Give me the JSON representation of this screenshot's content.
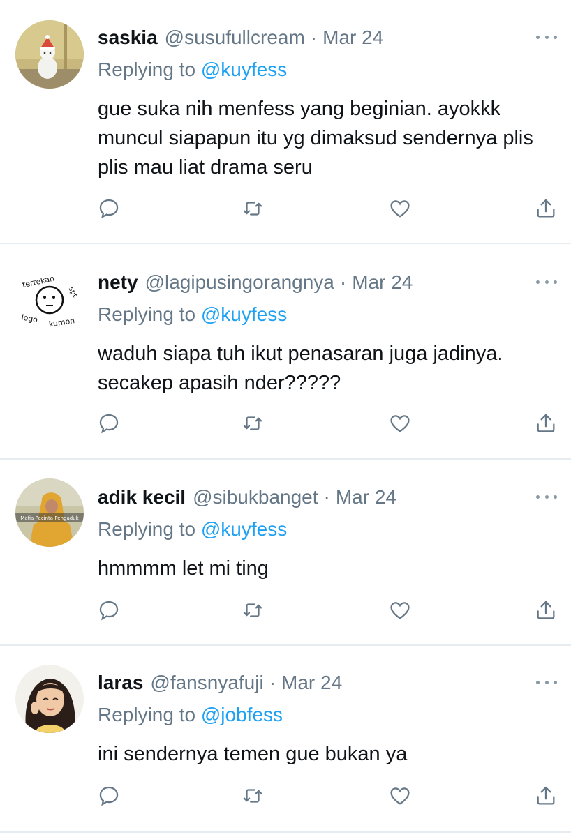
{
  "tweets": [
    {
      "name": "saskia",
      "handle": "@susufullcream",
      "date": "Mar 24",
      "replying_prefix": "Replying to",
      "replying_to": "@kuyfess",
      "text": "gue suka nih menfess yang beginian. ayokkk muncul siapapun itu yg dimaksud sendernya plis plis mau liat drama seru"
    },
    {
      "name": "nety",
      "handle": "@lagipusingorangnya",
      "date": "Mar 24",
      "replying_prefix": "Replying to",
      "replying_to": "@kuyfess",
      "text": "waduh siapa tuh ikut penasaran juga jadinya. secakep apasih nder?????",
      "avatar_text": [
        "tertekan",
        "spt",
        "logo",
        "kumon"
      ]
    },
    {
      "name": "adik kecil",
      "handle": "@sibukbanget",
      "date": "Mar 24",
      "replying_prefix": "Replying to",
      "replying_to": "@kuyfess",
      "text": "hmmmm let mi ting",
      "avatar_text": "Mafia Pecinta Pengaduk"
    },
    {
      "name": "laras",
      "handle": "@fansnyafuji",
      "date": "Mar 24",
      "replying_prefix": "Replying to",
      "replying_to": "@jobfess",
      "text": "ini sendernya temen gue bukan ya"
    }
  ],
  "separator": "·",
  "colors": {
    "accent": "#1da1f2",
    "secondary_text": "#657786",
    "icon": "#657786",
    "divider": "#e6ecf0"
  },
  "icons": {
    "reply": "speech-bubble-icon",
    "retweet": "retweet-icon",
    "like": "heart-icon",
    "share": "share-icon",
    "more": "more-dots-icon"
  }
}
